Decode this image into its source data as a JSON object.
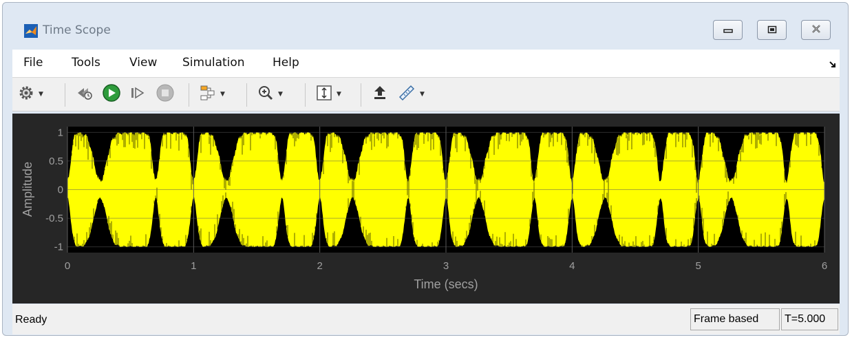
{
  "window": {
    "title": "Time Scope",
    "controls": [
      "minimize-icon",
      "restore-icon",
      "close-icon"
    ]
  },
  "menu": {
    "items": [
      "File",
      "Tools",
      "View",
      "Simulation",
      "Help"
    ],
    "undock_icon": "undock-arrow-icon"
  },
  "toolbar": {
    "groups": [
      [
        "settings-gear-icon"
      ],
      [
        "step-back-icon",
        "run-icon",
        "step-forward-icon",
        "stop-icon"
      ],
      [
        "signal-select-icon"
      ],
      [
        "zoom-in-icon"
      ],
      [
        "scale-axes-icon"
      ],
      [
        "highlight-block-icon",
        "measurement-icon"
      ]
    ]
  },
  "colors": {
    "trace": "#ffff00",
    "plot_background": "#000000",
    "panel_background": "#262626",
    "axes_text": "#a0a0a0",
    "grid": "#5a5a5a"
  },
  "status": {
    "text": "Ready",
    "mode": "Frame based",
    "time": "T=5.000"
  },
  "chart_data": {
    "type": "line",
    "xlabel": "Time (secs)",
    "ylabel": "Amplitude",
    "xlim": [
      0,
      6
    ],
    "ylim": [
      -1.1,
      1.1
    ],
    "xticks": [
      "0",
      "1",
      "2",
      "3",
      "4",
      "5",
      "6"
    ],
    "yticks": [
      "1",
      "0.5",
      "0",
      "-0.5",
      "-1"
    ],
    "ytick_values": [
      1,
      0.5,
      0,
      -0.5,
      -1
    ],
    "grid": true,
    "series": [
      {
        "color": "#ffff00",
        "description_period": 1,
        "envelope_dips_within_period": [
          0.0,
          0.26,
          0.7
        ],
        "min_value": -1,
        "max_value": 1
      }
    ]
  }
}
